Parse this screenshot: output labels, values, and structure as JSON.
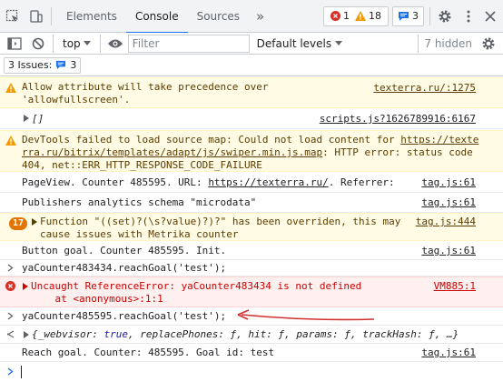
{
  "tabs": {
    "items": [
      "Elements",
      "Console",
      "Sources"
    ],
    "active": "Console",
    "more": "»"
  },
  "counters": {
    "errors": "1",
    "warnings": "18",
    "messages": "3"
  },
  "toolbar": {
    "context": "top",
    "filter_placeholder": "Filter",
    "levels": "Default levels",
    "hidden": "7 hidden"
  },
  "issues": {
    "label": "3 Issues:",
    "count": "3"
  },
  "console": {
    "m1": {
      "text": "Allow attribute will take precedence over\n'allowfullscreen'.",
      "src": "texterra.ru/:1275"
    },
    "m2": {
      "text": "[]",
      "src": "scripts.js?1626789916:6167"
    },
    "m3": {
      "text_a": "DevTools failed to load source map: Could not load content for ",
      "link": "https://texte\nrra.ru/bitrix/templates/adapt/js/swiper.min.js.map",
      "text_b": ": HTTP error: status code\n404, net::ERR_HTTP_RESPONSE_CODE_FAILURE"
    },
    "m4": {
      "text_a": "PageView. Counter 485595. URL: ",
      "link": "https://texterra.ru/",
      "text_b": ". Referrer:",
      "src": "tag.js:61"
    },
    "m5": {
      "text": "Publishers analytics schema \"microdata\"",
      "src": "tag.js:61"
    },
    "m6": {
      "count": "17",
      "text": "Function \"((set)?(\\s?value)?)?\" has been overriden, this may\ncause issues with Metrika counter",
      "src": "tag.js:444"
    },
    "m7": {
      "text": "Button goal. Counter 485595. Init.",
      "src": "tag.js:61"
    },
    "m8": {
      "text": "yaCounter483434.reachGoal('test');"
    },
    "m9": {
      "text": "Uncaught ReferenceError: yaCounter483434 is not defined\n    at <anonymous>:1:1",
      "src": "VM885:1"
    },
    "m10": {
      "text": "yaCounter485595.reachGoal('test');"
    },
    "m11": {
      "open": "{_webvisor: ",
      "v1": "true",
      "mid": ", replacePhones: ƒ, hit: ƒ, params: ƒ, trackHash: ƒ, …}"
    },
    "m12": {
      "text": "Reach goal. Counter: 485595. Goal id: test",
      "src": "tag.js:61"
    }
  },
  "colors": {
    "accent": "#1a73e8",
    "arrow": "#d32f2f"
  }
}
